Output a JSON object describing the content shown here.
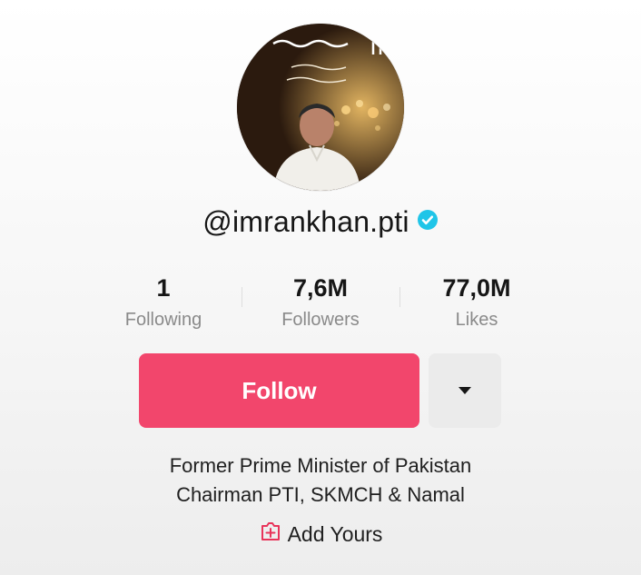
{
  "profile": {
    "username": "@imrankhan.pti",
    "verified_icon": "verified-badge-icon",
    "verified_color": "#20c5e8",
    "avatar_icon": "profile-avatar"
  },
  "stats": [
    {
      "value": "1",
      "label": "Following"
    },
    {
      "value": "7,6M",
      "label": "Followers"
    },
    {
      "value": "77,0M",
      "label": "Likes"
    }
  ],
  "actions": {
    "follow_label": "Follow",
    "follow_color": "#f2466c",
    "more_icon": "caret-down-icon"
  },
  "bio": {
    "line1": "Former Prime Minister of Pakistan",
    "line2": "Chairman PTI, SKMCH & Namal"
  },
  "add_yours": {
    "label": "Add Yours",
    "icon": "add-yours-icon",
    "icon_color": "#e8345a"
  }
}
